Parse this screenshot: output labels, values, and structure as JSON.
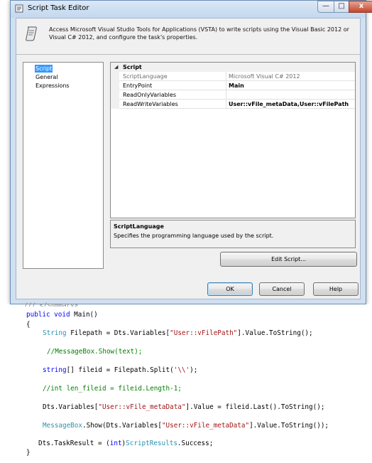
{
  "window": {
    "title": "Script Task Editor",
    "controls": {
      "minimize": "—",
      "maximize": "□",
      "close": "x"
    }
  },
  "header": {
    "description": "Access Microsoft Visual Studio Tools for Applications (VSTA) to write scripts using the Visual Basic 2012 or Visual C# 2012, and configure the task's properties."
  },
  "nav": {
    "items": [
      {
        "label": "Script",
        "selected": true
      },
      {
        "label": "General",
        "selected": false
      },
      {
        "label": "Expressions",
        "selected": false
      }
    ]
  },
  "properties": {
    "category": "Script",
    "rows": [
      {
        "name": "ScriptLanguage",
        "value": "Microsoft Visual C# 2012",
        "readonly": true
      },
      {
        "name": "EntryPoint",
        "value": "Main",
        "readonly": false
      },
      {
        "name": "ReadOnlyVariables",
        "value": "",
        "readonly": false
      },
      {
        "name": "ReadWriteVariables",
        "value": "User::vFile_metaData,User::vFilePath",
        "readonly": false
      }
    ]
  },
  "description_panel": {
    "title": "ScriptLanguage",
    "text": "Specifies the programming language used by the script."
  },
  "buttons": {
    "edit_script": "Edit Script...",
    "ok": "OK",
    "cancel": "Cancel",
    "help": "Help"
  },
  "code": {
    "partial_top": "/// </summary>",
    "lines": [
      [
        {
          "t": "public void ",
          "c": "kw"
        },
        {
          "t": "Main()",
          "c": ""
        }
      ],
      [
        {
          "t": "{",
          "c": ""
        }
      ],
      [
        {
          "t": "String",
          "c": "ty"
        },
        {
          "t": " Filepath = Dts.Variables[",
          "c": ""
        },
        {
          "t": "\"User::vFilePath\"",
          "c": "st"
        },
        {
          "t": "].Value.ToString();",
          "c": ""
        }
      ],
      [
        {
          "t": "//MessageBox.Show(text);",
          "c": "cm"
        }
      ],
      [
        {
          "t": "string",
          "c": "kw"
        },
        {
          "t": "[] fileid = Filepath.Split(",
          "c": ""
        },
        {
          "t": "'\\\\'",
          "c": "st"
        },
        {
          "t": ");",
          "c": ""
        }
      ],
      [
        {
          "t": "//int len_fileid = fileid.Length-1;",
          "c": "cm"
        }
      ],
      [
        {
          "t": "Dts.Variables[",
          "c": ""
        },
        {
          "t": "\"User::vFile_metaData\"",
          "c": "st"
        },
        {
          "t": "].Value = fileid.Last().ToString();",
          "c": ""
        }
      ],
      [
        {
          "t": "MessageBox",
          "c": "ty"
        },
        {
          "t": ".Show(Dts.Variables[",
          "c": ""
        },
        {
          "t": "\"User::vFile_metaData\"",
          "c": "st"
        },
        {
          "t": "].Value.ToString());",
          "c": ""
        }
      ],
      [
        {
          "t": "Dts.TaskResult = (",
          "c": ""
        },
        {
          "t": "int",
          "c": "kw"
        },
        {
          "t": ")",
          "c": ""
        },
        {
          "t": "ScriptResults",
          "c": "ty"
        },
        {
          "t": ".Success;",
          "c": ""
        }
      ],
      [
        {
          "t": "}",
          "c": ""
        }
      ]
    ]
  }
}
